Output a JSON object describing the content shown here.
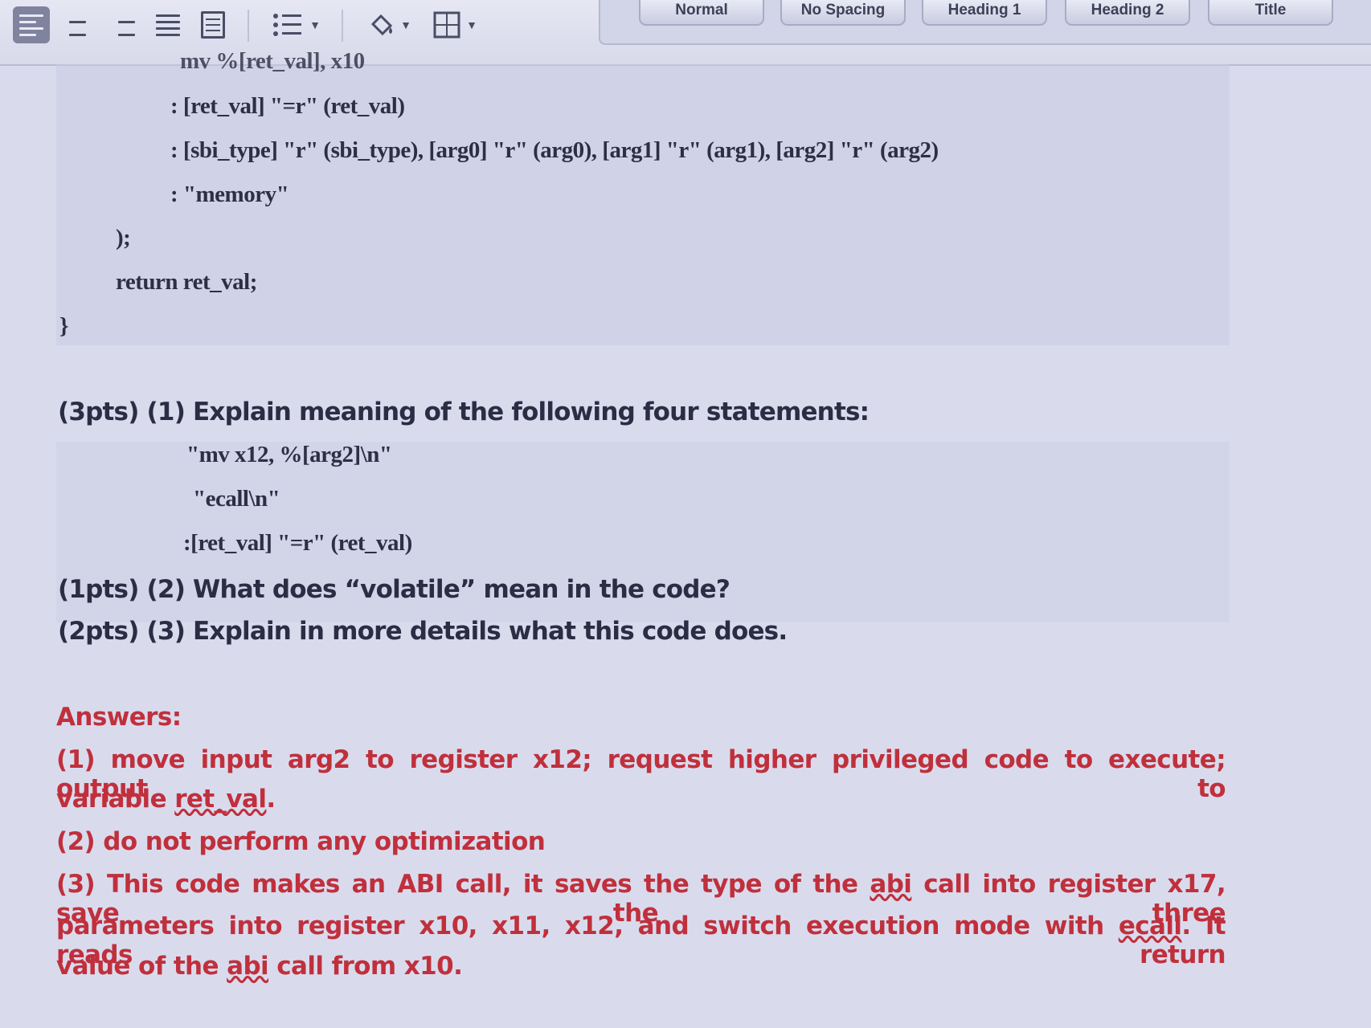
{
  "toolbar": {
    "icons": [
      "align-left-icon",
      "align-center-icon",
      "align-right-icon",
      "justify-icon",
      "distributed-icon",
      "bullet-list-icon",
      "fill-color-icon",
      "borders-icon"
    ],
    "styles": [
      "Normal",
      "No Spacing",
      "Heading 1",
      "Heading 2",
      "Title"
    ]
  },
  "code": {
    "line0": "mv %[ret_val], x10",
    "line1": ": [ret_val] \"=r\" (ret_val)",
    "line2": ": [sbi_type] \"r\" (sbi_type), [arg0] \"r\" (arg0), [arg1] \"r\" (arg1), [arg2] \"r\" (arg2)",
    "line3": ": \"memory\"",
    "line4": ");",
    "line5": "return ret_val;",
    "line6": "}"
  },
  "question": {
    "q1": "(3pts) (1) Explain meaning of the following four statements:",
    "s1": "\"mv x12, %[arg2]\\n\"",
    "s2": "\"ecall\\n\"",
    "s3": ":[ret_val] \"=r\" (ret_val)",
    "q2": "(1pts) (2) What does “volatile” mean in the code?",
    "q3": "(2pts) (3) Explain in more details what this code does."
  },
  "answers": {
    "heading": "Answers:",
    "a1_line1": "(1) move input arg2 to register x12; request higher privileged code to execute; output to",
    "a1_line2_pre": "variable ",
    "a1_line2_u": "ret_val",
    "a1_line2_post": ".",
    "a2": "(2) do not perform any optimization",
    "a3_l1_pre": "(3) This code makes an ABI call, it saves the type of the ",
    "a3_l1_u": "abi",
    "a3_l1_post": " call into register x17, save the three",
    "a3_l2_pre": "parameters into register x10, x11, x12, and switch execution mode with ",
    "a3_l2_u": "ecall",
    "a3_l2_post": ". It reads return",
    "a3_l3_pre": "value of the ",
    "a3_l3_u": "abi",
    "a3_l3_post": " call from x10."
  }
}
